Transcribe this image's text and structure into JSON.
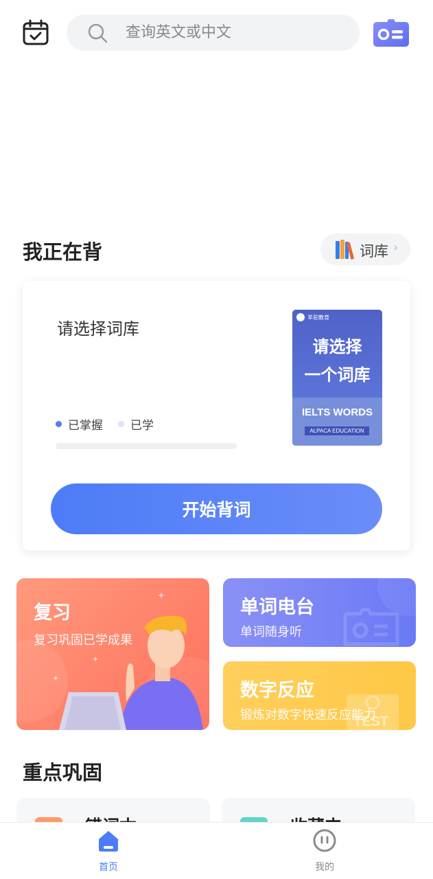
{
  "search": {
    "placeholder": "查询英文或中文"
  },
  "current": {
    "title": "我正在背",
    "library_label": "词库",
    "prompt": "请选择词库",
    "legend": {
      "mastered": "已掌握",
      "learned": "已学"
    },
    "progress": 0,
    "cover": {
      "brand": "羊驼教育",
      "line1": "请选择",
      "line2": "一个词库",
      "series": "IELTS WORDS",
      "publisher": "ALPACA EDUCATION"
    },
    "start_label": "开始背词"
  },
  "tiles": {
    "review": {
      "title": "复习",
      "subtitle": "复习巩固已学成果"
    },
    "radio": {
      "title": "单词电台",
      "subtitle": "单词随身听"
    },
    "numbers": {
      "title": "数字反应",
      "subtitle": "锻炼对数字快速反应能力",
      "watermark": "TEST"
    }
  },
  "focus": {
    "title": "重点巩固",
    "items": [
      {
        "label": "错词本"
      },
      {
        "label": "收藏夹"
      }
    ]
  },
  "tabbar": {
    "home": "首页",
    "mine": "我的"
  },
  "colors": {
    "accent": "#4d7cf7",
    "tab_inactive": "#8a8a8a",
    "review": "#ff7a62",
    "radio": "#7682f6",
    "numbers": "#ffc94d"
  }
}
